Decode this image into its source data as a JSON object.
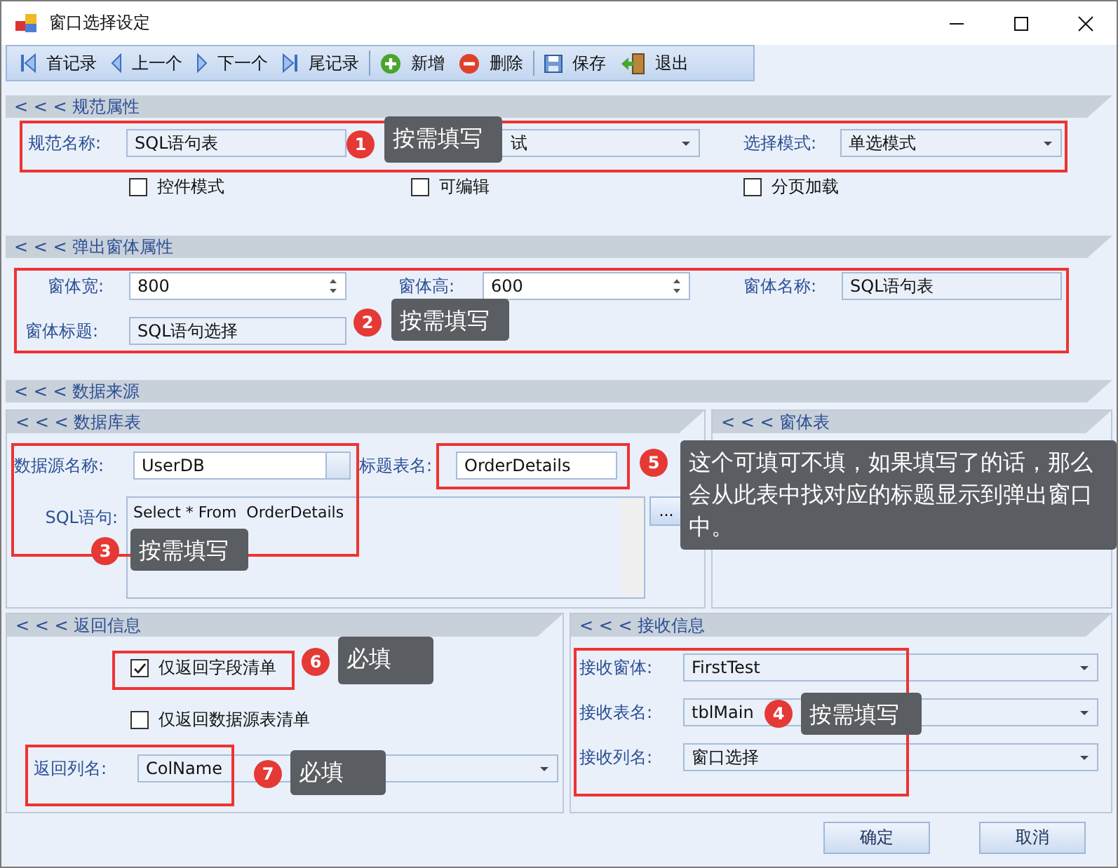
{
  "window": {
    "title": "窗口选择设定"
  },
  "toolbar": [
    {
      "label": "首记录",
      "kind": "first",
      "separator_before": false
    },
    {
      "label": "上一个",
      "kind": "prev",
      "separator_before": false
    },
    {
      "label": "下一个",
      "kind": "next",
      "separator_before": false
    },
    {
      "label": "尾记录",
      "kind": "last",
      "separator_before": false
    },
    {
      "label": "新增",
      "kind": "add",
      "separator_before": true
    },
    {
      "label": "删除",
      "kind": "delete",
      "separator_before": false
    },
    {
      "label": "保存",
      "kind": "save",
      "separator_before": true
    },
    {
      "label": "退出",
      "kind": "exit",
      "separator_before": false
    }
  ],
  "spec": {
    "header": "< < < 规范属性",
    "name_label": "规范名称:",
    "name_value": "SQL语句表",
    "category_value": "试",
    "mode_label": "选择模式:",
    "mode_value": "单选模式",
    "checkboxes": [
      {
        "label": "控件模式",
        "checked": false
      },
      {
        "label": "可编辑",
        "checked": false
      },
      {
        "label": "分页加载",
        "checked": false
      }
    ]
  },
  "popup": {
    "header": "< < < 弹出窗体属性",
    "width_label": "窗体宽:",
    "width_value": "800",
    "height_label": "窗体高:",
    "height_value": "600",
    "name_label": "窗体名称:",
    "name_value": "SQL语句表",
    "title_label": "窗体标题:",
    "title_value": "SQL语句选择"
  },
  "source": {
    "header": "< < < 数据来源",
    "db_header": "< < < 数据库表",
    "ds_label": "数据源名称:",
    "ds_value": "UserDB",
    "title_table_label": "标题表名:",
    "title_table_value": "OrderDetails",
    "sql_label": "SQL语句:",
    "sql_value": "Select * From  OrderDetails",
    "browse_button": "...",
    "form_header": "< < < 窗体表"
  },
  "return": {
    "header": "< < < 返回信息",
    "checkboxes": [
      {
        "label": "仅返回字段清单",
        "checked": true
      },
      {
        "label": "仅返回数据源表清单",
        "checked": false
      }
    ],
    "col_label": "返回列名:",
    "col_value": "ColName"
  },
  "receive": {
    "header": "< < < 接收信息",
    "rows": [
      {
        "label": "接收窗体:",
        "value": "FirstTest"
      },
      {
        "label": "接收表名:",
        "value": "tblMain"
      },
      {
        "label": "接收列名:",
        "value": "窗口选择"
      }
    ]
  },
  "buttons": [
    "确定",
    "取消"
  ],
  "callouts": [
    {
      "number": "1",
      "text": "按需填写"
    },
    {
      "number": "2",
      "text": "按需填写"
    },
    {
      "number": "5",
      "text": "这个可填可不填，如果填写了的话，那么会从此表中找对应的标题显示到弹出窗口中。"
    },
    {
      "number": "3",
      "text": "按需填写"
    },
    {
      "number": "6",
      "text": "必填"
    },
    {
      "number": "4",
      "text": "按需填写"
    },
    {
      "number": "7",
      "text": "必填"
    }
  ]
}
